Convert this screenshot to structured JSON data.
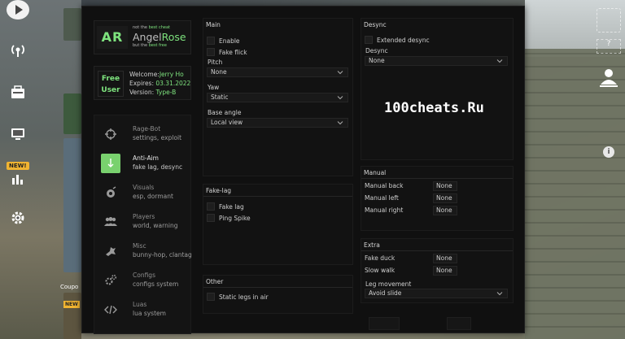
{
  "window": {
    "brand": {
      "logo": "AR",
      "tagline_top_1": "not the ",
      "tagline_top_2": "best cheat",
      "name_1": "Angel",
      "name_2": "Rose",
      "tagline_bot_1": "but the ",
      "tagline_bot_2": "best free"
    },
    "user": {
      "tier_1": "Free",
      "tier_2": "User",
      "welcome_label": "Welcome:",
      "welcome_value": "Jerry Ho",
      "expires_label": "Expires: ",
      "expires_value": "03.31.2022",
      "version_label": "Version: ",
      "version_value": "Type-B"
    },
    "nav": [
      {
        "title": "Rage-Bot",
        "sub": "settings, exploit",
        "icon": "crosshair-icon",
        "active": false
      },
      {
        "title": "Anti-Aim",
        "sub": "fake lag, desync",
        "icon": "anti-aim-icon",
        "active": true
      },
      {
        "title": "Visuals",
        "sub": "esp, dormant",
        "icon": "visuals-icon",
        "active": false
      },
      {
        "title": "Players",
        "sub": "world, warning",
        "icon": "players-icon",
        "active": false
      },
      {
        "title": "Misc",
        "sub": "bunny-hop, clantag",
        "icon": "misc-icon",
        "active": false
      },
      {
        "title": "Configs",
        "sub": "configs system",
        "icon": "gears-icon",
        "active": false
      },
      {
        "title": "Luas",
        "sub": "lua system",
        "icon": "code-icon",
        "active": false
      }
    ],
    "main": {
      "title": "Main",
      "enable": "Enable",
      "fake_flick": "Fake flick",
      "pitch_label": "Pitch",
      "pitch_value": "None",
      "yaw_label": "Yaw",
      "yaw_value": "Static",
      "base_angle_label": "Base angle",
      "base_angle_value": "Local view"
    },
    "fakelag": {
      "title": "Fake-lag",
      "fake_lag": "Fake lag",
      "ping_spike": "Ping Spike"
    },
    "other": {
      "title": "Other",
      "static_legs": "Static legs in air"
    },
    "desync": {
      "title": "Desync",
      "extended": "Extended desync",
      "desync_label": "Desync",
      "desync_value": "None"
    },
    "manual": {
      "title": "Manual",
      "rows": [
        {
          "label": "Manual back",
          "value": "None"
        },
        {
          "label": "Manual left",
          "value": "None"
        },
        {
          "label": "Manual right",
          "value": "None"
        }
      ]
    },
    "extra": {
      "title": "Extra",
      "rows": [
        {
          "label": "Fake duck",
          "value": "None"
        },
        {
          "label": "Slow walk",
          "value": "None"
        }
      ],
      "leg_label": "Leg movement",
      "leg_value": "Avoid slide"
    }
  },
  "watermark": "100cheats.Ru",
  "game": {
    "new_badge": "NEW!",
    "coupon": "Coupo",
    "new_small": "NEW",
    "right_q": "?"
  },
  "colors": {
    "accent": "#7ee37e",
    "menu_bg": "#101010"
  }
}
